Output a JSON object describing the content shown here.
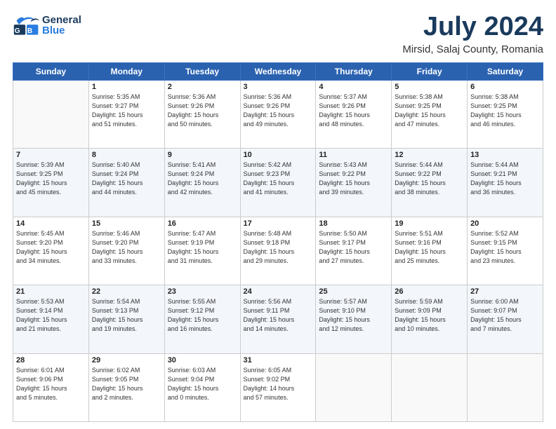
{
  "header": {
    "logo_general": "General",
    "logo_blue": "Blue",
    "month": "July 2024",
    "location": "Mirsid, Salaj County, Romania"
  },
  "days_of_week": [
    "Sunday",
    "Monday",
    "Tuesday",
    "Wednesday",
    "Thursday",
    "Friday",
    "Saturday"
  ],
  "weeks": [
    [
      {
        "day": "",
        "info": ""
      },
      {
        "day": "1",
        "info": "Sunrise: 5:35 AM\nSunset: 9:27 PM\nDaylight: 15 hours\nand 51 minutes."
      },
      {
        "day": "2",
        "info": "Sunrise: 5:36 AM\nSunset: 9:26 PM\nDaylight: 15 hours\nand 50 minutes."
      },
      {
        "day": "3",
        "info": "Sunrise: 5:36 AM\nSunset: 9:26 PM\nDaylight: 15 hours\nand 49 minutes."
      },
      {
        "day": "4",
        "info": "Sunrise: 5:37 AM\nSunset: 9:26 PM\nDaylight: 15 hours\nand 48 minutes."
      },
      {
        "day": "5",
        "info": "Sunrise: 5:38 AM\nSunset: 9:25 PM\nDaylight: 15 hours\nand 47 minutes."
      },
      {
        "day": "6",
        "info": "Sunrise: 5:38 AM\nSunset: 9:25 PM\nDaylight: 15 hours\nand 46 minutes."
      }
    ],
    [
      {
        "day": "7",
        "info": "Sunrise: 5:39 AM\nSunset: 9:25 PM\nDaylight: 15 hours\nand 45 minutes."
      },
      {
        "day": "8",
        "info": "Sunrise: 5:40 AM\nSunset: 9:24 PM\nDaylight: 15 hours\nand 44 minutes."
      },
      {
        "day": "9",
        "info": "Sunrise: 5:41 AM\nSunset: 9:24 PM\nDaylight: 15 hours\nand 42 minutes."
      },
      {
        "day": "10",
        "info": "Sunrise: 5:42 AM\nSunset: 9:23 PM\nDaylight: 15 hours\nand 41 minutes."
      },
      {
        "day": "11",
        "info": "Sunrise: 5:43 AM\nSunset: 9:22 PM\nDaylight: 15 hours\nand 39 minutes."
      },
      {
        "day": "12",
        "info": "Sunrise: 5:44 AM\nSunset: 9:22 PM\nDaylight: 15 hours\nand 38 minutes."
      },
      {
        "day": "13",
        "info": "Sunrise: 5:44 AM\nSunset: 9:21 PM\nDaylight: 15 hours\nand 36 minutes."
      }
    ],
    [
      {
        "day": "14",
        "info": "Sunrise: 5:45 AM\nSunset: 9:20 PM\nDaylight: 15 hours\nand 34 minutes."
      },
      {
        "day": "15",
        "info": "Sunrise: 5:46 AM\nSunset: 9:20 PM\nDaylight: 15 hours\nand 33 minutes."
      },
      {
        "day": "16",
        "info": "Sunrise: 5:47 AM\nSunset: 9:19 PM\nDaylight: 15 hours\nand 31 minutes."
      },
      {
        "day": "17",
        "info": "Sunrise: 5:48 AM\nSunset: 9:18 PM\nDaylight: 15 hours\nand 29 minutes."
      },
      {
        "day": "18",
        "info": "Sunrise: 5:50 AM\nSunset: 9:17 PM\nDaylight: 15 hours\nand 27 minutes."
      },
      {
        "day": "19",
        "info": "Sunrise: 5:51 AM\nSunset: 9:16 PM\nDaylight: 15 hours\nand 25 minutes."
      },
      {
        "day": "20",
        "info": "Sunrise: 5:52 AM\nSunset: 9:15 PM\nDaylight: 15 hours\nand 23 minutes."
      }
    ],
    [
      {
        "day": "21",
        "info": "Sunrise: 5:53 AM\nSunset: 9:14 PM\nDaylight: 15 hours\nand 21 minutes."
      },
      {
        "day": "22",
        "info": "Sunrise: 5:54 AM\nSunset: 9:13 PM\nDaylight: 15 hours\nand 19 minutes."
      },
      {
        "day": "23",
        "info": "Sunrise: 5:55 AM\nSunset: 9:12 PM\nDaylight: 15 hours\nand 16 minutes."
      },
      {
        "day": "24",
        "info": "Sunrise: 5:56 AM\nSunset: 9:11 PM\nDaylight: 15 hours\nand 14 minutes."
      },
      {
        "day": "25",
        "info": "Sunrise: 5:57 AM\nSunset: 9:10 PM\nDaylight: 15 hours\nand 12 minutes."
      },
      {
        "day": "26",
        "info": "Sunrise: 5:59 AM\nSunset: 9:09 PM\nDaylight: 15 hours\nand 10 minutes."
      },
      {
        "day": "27",
        "info": "Sunrise: 6:00 AM\nSunset: 9:07 PM\nDaylight: 15 hours\nand 7 minutes."
      }
    ],
    [
      {
        "day": "28",
        "info": "Sunrise: 6:01 AM\nSunset: 9:06 PM\nDaylight: 15 hours\nand 5 minutes."
      },
      {
        "day": "29",
        "info": "Sunrise: 6:02 AM\nSunset: 9:05 PM\nDaylight: 15 hours\nand 2 minutes."
      },
      {
        "day": "30",
        "info": "Sunrise: 6:03 AM\nSunset: 9:04 PM\nDaylight: 15 hours\nand 0 minutes."
      },
      {
        "day": "31",
        "info": "Sunrise: 6:05 AM\nSunset: 9:02 PM\nDaylight: 14 hours\nand 57 minutes."
      },
      {
        "day": "",
        "info": ""
      },
      {
        "day": "",
        "info": ""
      },
      {
        "day": "",
        "info": ""
      }
    ]
  ]
}
